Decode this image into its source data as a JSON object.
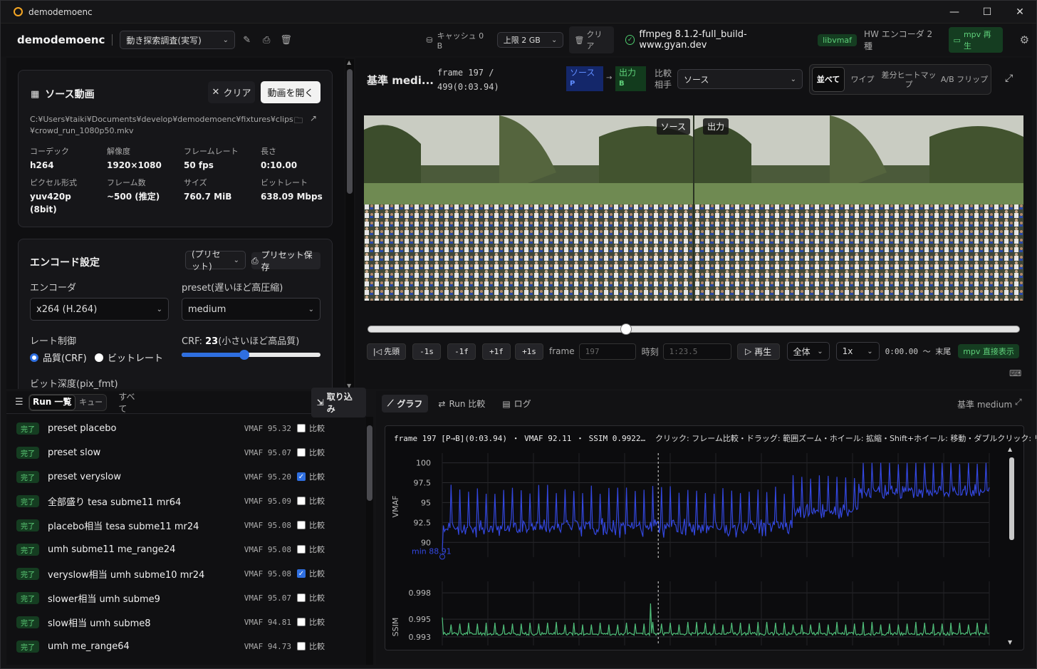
{
  "window": {
    "title": "demodemoenc",
    "controls": [
      "—",
      "☐",
      "✕"
    ]
  },
  "toolbar": {
    "brand": "demodemoenc",
    "project": "動き探索調査(実写)",
    "cache": "キャッシュ 0 B",
    "limit": "上限 2 GB",
    "clear": "クリア",
    "ffmpeg": "ffmpeg 8.1.2-full_build-www.gyan.dev",
    "libvmaf": "libvmaf",
    "hw": "HW エンコーダ 2 種",
    "mpv": "mpv 再生"
  },
  "source": {
    "title": "ソース動画",
    "clear": "クリア",
    "open": "動画を開く",
    "path": "C:¥Users¥taiki¥Documents¥develop¥demodemoenc¥fixtures¥clips¥crowd_run_1080p50.mkv",
    "fields": [
      {
        "label": "コーデック",
        "value": "h264"
      },
      {
        "label": "解像度",
        "value": "1920×1080"
      },
      {
        "label": "フレームレート",
        "value": "50 fps"
      },
      {
        "label": "長さ",
        "value": "0:10.00"
      },
      {
        "label": "ピクセル形式",
        "value": "yuv420p (8bit)"
      },
      {
        "label": "フレーム数",
        "value": "~500 (推定)"
      },
      {
        "label": "サイズ",
        "value": "760.7 MiB"
      },
      {
        "label": "ビットレート",
        "value": "638.09 Mbps"
      }
    ]
  },
  "encode": {
    "title": "エンコード設定",
    "preset_select": "(プリセット)",
    "preset_save": "プリセット保存",
    "encoder_label": "エンコーダ",
    "encoder": "x264 (H.264)",
    "preset_label": "preset(遅いほど高圧縮)",
    "preset": "medium",
    "rc_label": "レート制御",
    "rc_crf": "品質(CRF)",
    "rc_bitrate": "ビットレート",
    "crf_prefix": "CRF: ",
    "crf_value": "23",
    "crf_suffix": "(小さいほど高品質)",
    "crf_fraction": 0.45,
    "bitdepth_label": "ビット深度(pix_fmt)"
  },
  "viewer": {
    "title": "基準 medi...",
    "frame_info": "frame 197 / 499(0:03.94)",
    "src_label": "ソース",
    "src_sub": "P",
    "out_label": "出力",
    "out_sub": "B",
    "compare_label": "比較 相手",
    "compare_value": "ソース",
    "modes": [
      "並べて",
      "ワイプ",
      "差分ヒートマップ",
      "A/B フリップ"
    ],
    "tag_left": "ソース",
    "tag_right": "出力"
  },
  "playback": {
    "position": 0.395,
    "head": "先頭",
    "m1s": "-1s",
    "m1f": "-1f",
    "p1f": "+1f",
    "p1s": "+1s",
    "frame_label": "frame",
    "frame_value": "197",
    "time_label": "時刻",
    "time_value": "1:23.5",
    "play": "再生",
    "range": "全体",
    "speed": "1x",
    "range_text": "0:00.00 〜 末尾",
    "mpv_direct": "mpv 直接表示"
  },
  "runs": {
    "tab_list": "Run 一覧",
    "tab_queue": "キュー",
    "all": "すべて",
    "import": "取り込み",
    "compare_label": "比較",
    "items": [
      {
        "status": "完了",
        "name": "preset placebo",
        "vmaf": "VMAF 95.32",
        "checked": false
      },
      {
        "status": "完了",
        "name": "preset slow",
        "vmaf": "VMAF 95.07",
        "checked": false
      },
      {
        "status": "完了",
        "name": "preset veryslow",
        "vmaf": "VMAF 95.20",
        "checked": true
      },
      {
        "status": "完了",
        "name": "全部盛り tesa subme11 mr64",
        "vmaf": "VMAF 95.09",
        "checked": false
      },
      {
        "status": "完了",
        "name": "placebo相当 tesa subme11 mr24",
        "vmaf": "VMAF 95.08",
        "checked": false
      },
      {
        "status": "完了",
        "name": "umh subme11 me_range24",
        "vmaf": "VMAF 95.08",
        "checked": false
      },
      {
        "status": "完了",
        "name": "veryslow相当 umh subme10 mr24",
        "vmaf": "VMAF 95.08",
        "checked": true
      },
      {
        "status": "完了",
        "name": "slower相当 umh subme9",
        "vmaf": "VMAF 95.07",
        "checked": false
      },
      {
        "status": "完了",
        "name": "slow相当 umh subme8",
        "vmaf": "VMAF 94.81",
        "checked": false
      },
      {
        "status": "完了",
        "name": "umh me_range64",
        "vmaf": "VMAF 94.73",
        "checked": false
      }
    ]
  },
  "graph": {
    "tab_graph": "グラフ",
    "tab_compare": "Run 比較",
    "tab_log": "ログ",
    "baseline": "基準 medium",
    "info": "frame 197 [P→B](0:03.94) ・ VMAF 92.11 ・ SSIM 0.9922…",
    "hint": "クリック: フレーム比較・ドラッグ: 範囲ズーム・ホイール: 拡縮・Shift+ホイール: 移動・ダブルクリック: リセット",
    "vmaf_axis": "VMAF",
    "ssim_axis": "SSIM",
    "vmaf_ticks": [
      "100",
      "97.5",
      "95",
      "92.5",
      "90"
    ],
    "ssim_ticks": [
      "0.998",
      "0.995",
      "0.993"
    ],
    "min_label": "min 88.91",
    "colors": {
      "vmaf": "#3347e0",
      "ssim": "#4fbf7a"
    }
  },
  "chart_data": [
    {
      "type": "line",
      "series": [
        {
          "name": "VMAF",
          "values": []
        }
      ],
      "ylabel": "VMAF",
      "ylim": [
        88.5,
        100.5
      ],
      "xlim": [
        0,
        499
      ],
      "cursor_frame": 197
    },
    {
      "type": "line",
      "series": [
        {
          "name": "SSIM",
          "values": []
        }
      ],
      "ylabel": "SSIM",
      "ylim": [
        0.9925,
        0.9985
      ],
      "xlim": [
        0,
        499
      ],
      "cursor_frame": 197
    }
  ]
}
